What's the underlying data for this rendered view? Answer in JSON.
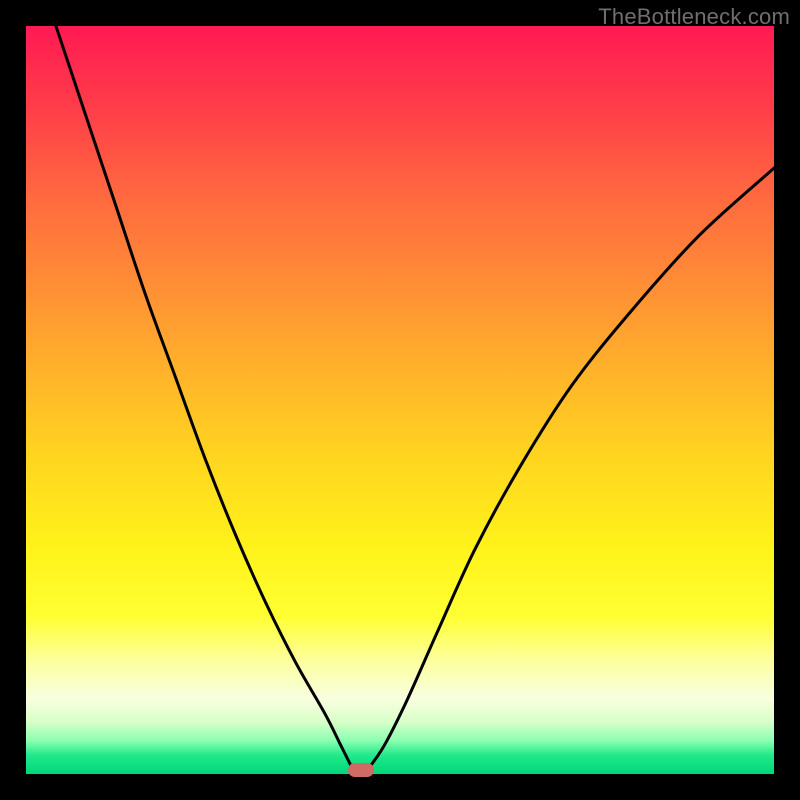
{
  "watermark": "TheBottleneck.com",
  "colors": {
    "curve": "#000000",
    "marker": "#cf6a64",
    "frame": "#000000"
  },
  "chart_data": {
    "type": "line",
    "title": "",
    "xlabel": "",
    "ylabel": "",
    "xlim": [
      0,
      100
    ],
    "ylim": [
      0,
      100
    ],
    "grid": false,
    "legend": "none",
    "series": [
      {
        "name": "left-branch",
        "x": [
          4,
          8,
          12,
          16,
          20,
          24,
          28,
          32,
          36,
          40,
          42,
          43.5
        ],
        "y": [
          100,
          88,
          76,
          64,
          53,
          42,
          32,
          23,
          15,
          8,
          4,
          1
        ]
      },
      {
        "name": "right-branch",
        "x": [
          46,
          48,
          51,
          55,
          60,
          66,
          73,
          81,
          90,
          100
        ],
        "y": [
          1,
          4,
          10,
          19,
          30,
          41,
          52,
          62,
          72,
          81
        ]
      }
    ],
    "marker": {
      "x": 44.8,
      "y": 0.5
    },
    "background_gradient": {
      "type": "vertical",
      "stops": [
        {
          "pos": 0.0,
          "color": "#ff1a53"
        },
        {
          "pos": 0.5,
          "color": "#ffb22a"
        },
        {
          "pos": 0.78,
          "color": "#ffff33"
        },
        {
          "pos": 0.95,
          "color": "#8cffb2"
        },
        {
          "pos": 1.0,
          "color": "#00d87a"
        }
      ]
    }
  }
}
